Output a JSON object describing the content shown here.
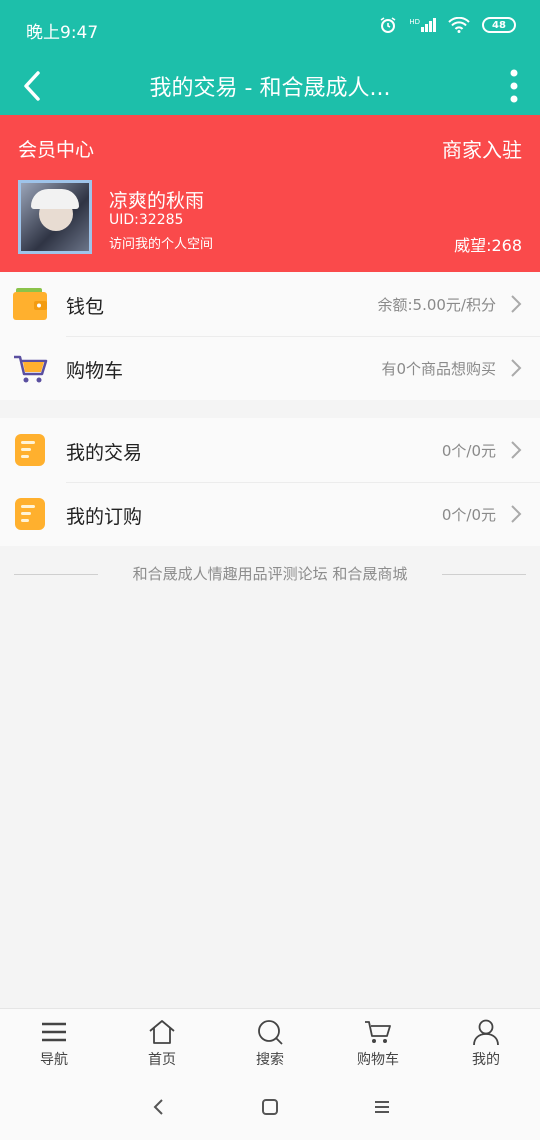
{
  "status_bar": {
    "time": "晚上9:47",
    "battery": "48",
    "signal_label": "HD"
  },
  "header": {
    "title": "我的交易 - 和合晟成人..."
  },
  "member": {
    "center_label": "会员中心",
    "merchant_label": "商家入驻",
    "username": "凉爽的秋雨",
    "uid": "UID:32285",
    "visit_space": "访问我的个人空间",
    "prestige": "威望:268"
  },
  "account_items": [
    {
      "label": "钱包",
      "value": "余额:5.00元/积分",
      "icon": "wallet-icon"
    },
    {
      "label": "购物车",
      "value": "有0个商品想购买",
      "icon": "cart-icon"
    }
  ],
  "trade_items": [
    {
      "label": "我的交易",
      "value": "0个/0元",
      "icon": "document-icon"
    },
    {
      "label": "我的订购",
      "value": "0个/0元",
      "icon": "document-icon"
    }
  ],
  "footer_text": "和合晟成人情趣用品评测论坛 和合晟商城",
  "bottom_nav": [
    {
      "label": "导航",
      "icon": "menu-icon"
    },
    {
      "label": "首页",
      "icon": "home-icon"
    },
    {
      "label": "搜索",
      "icon": "search-icon"
    },
    {
      "label": "购物车",
      "icon": "cart-outline-icon"
    },
    {
      "label": "我的",
      "icon": "user-icon"
    }
  ],
  "colors": {
    "header": "#1dbfaa",
    "member_bg": "#fa4a4b",
    "icon_orange": "#ffb02e"
  }
}
